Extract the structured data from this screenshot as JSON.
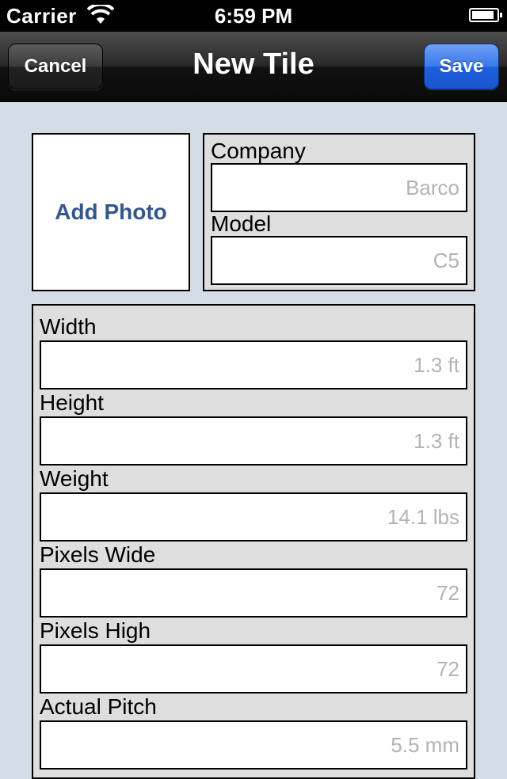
{
  "status_bar": {
    "carrier": "Carrier",
    "time": "6:59 PM",
    "battery_level": 0.9
  },
  "nav": {
    "title": "New Tile",
    "cancel_label": "Cancel",
    "save_label": "Save"
  },
  "photo": {
    "label": "Add Photo"
  },
  "company_fields": [
    {
      "label": "Company",
      "value": "",
      "placeholder": "Barco"
    },
    {
      "label": "Model",
      "value": "",
      "placeholder": "C5"
    }
  ],
  "spec_fields": [
    {
      "label": "Width",
      "value": "",
      "placeholder": "1.3 ft"
    },
    {
      "label": "Height",
      "value": "",
      "placeholder": "1.3 ft"
    },
    {
      "label": "Weight",
      "value": "",
      "placeholder": "14.1 lbs"
    },
    {
      "label": "Pixels Wide",
      "value": "",
      "placeholder": "72"
    },
    {
      "label": "Pixels High",
      "value": "",
      "placeholder": "72"
    },
    {
      "label": "Actual Pitch",
      "value": "",
      "placeholder": "5.5 mm"
    }
  ],
  "colors": {
    "nav_dark": "#1a1a1a",
    "save_blue": "#1d5fdc",
    "link_blue": "#34568c",
    "background": "#d4dde6"
  },
  "icons": {
    "wifi": "wifi-icon",
    "battery": "battery-icon"
  }
}
